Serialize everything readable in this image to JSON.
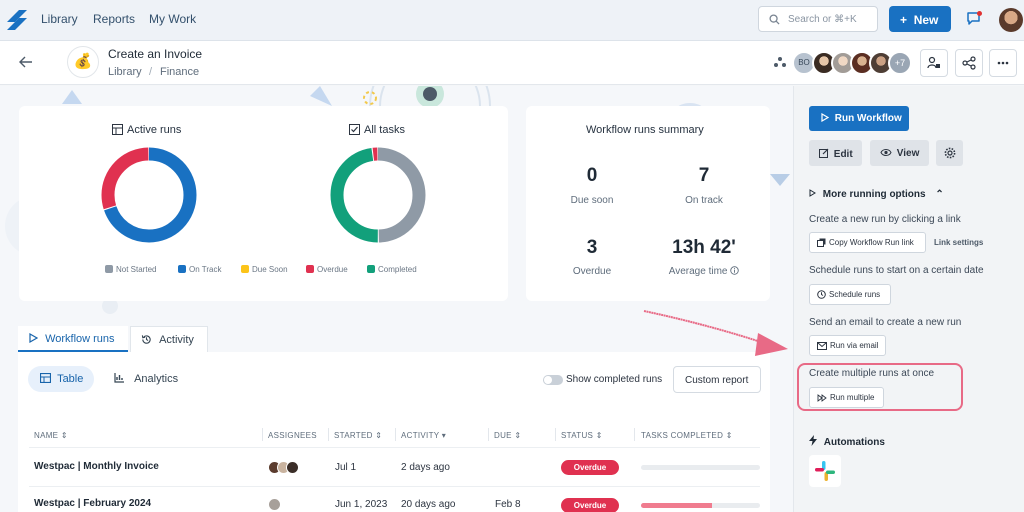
{
  "nav": {
    "library": "Library",
    "reports": "Reports",
    "my_work": "My Work",
    "search_placeholder": "Search or ⌘+K",
    "new_label": "New"
  },
  "header": {
    "title": "Create an Invoice",
    "crumb_library": "Library",
    "crumb_sep": "/",
    "crumb_finance": "Finance",
    "assignee_initials": "BO",
    "assignee_more": "+7",
    "icon": "💰"
  },
  "cards": {
    "active_runs": "Active runs",
    "all_tasks": "All tasks",
    "summary_title": "Workflow runs summary",
    "legend": [
      "Not Started",
      "On Track",
      "Due Soon",
      "Overdue",
      "Completed"
    ],
    "legend_colors": [
      "#8f9aa6",
      "#1971c2",
      "#fcc419",
      "#e03150",
      "#12a07b"
    ],
    "active_runs_chart": {
      "on_track": 7,
      "overdue": 3
    },
    "all_tasks_chart": {
      "completed": 48,
      "overdue": 2,
      "not_started": 50
    }
  },
  "summary": {
    "due_soon_value": "0",
    "due_soon_label": "Due soon",
    "on_track_value": "7",
    "on_track_label": "On track",
    "overdue_value": "3",
    "overdue_label": "Overdue",
    "avg_value": "13h 42'",
    "avg_label": "Average time"
  },
  "tabs": {
    "workflow_runs": "Workflow runs",
    "activity": "Activity",
    "table": "Table",
    "analytics": "Analytics",
    "show_completed": "Show completed runs",
    "custom_report": "Custom report"
  },
  "table": {
    "headers": [
      "NAME",
      "ASSIGNEES",
      "STARTED",
      "ACTIVITY",
      "DUE",
      "STATUS",
      "TASKS COMPLETED"
    ],
    "rows": [
      {
        "name": "Westpac | Monthly Invoice",
        "started": "Jul 1",
        "activity": "2 days ago",
        "due": "",
        "status": "Overdue",
        "progress": 0.0
      },
      {
        "name": "Westpac | February 2024",
        "started": "Jun 1, 2023",
        "activity": "20 days ago",
        "due": "Feb 8",
        "status": "Overdue",
        "progress": 0.6
      }
    ]
  },
  "panel": {
    "run_workflow": "Run Workflow",
    "edit": "Edit",
    "view": "View",
    "more_options": "More running options",
    "link_text": "Create a new run by clicking a link",
    "copy_link": "Copy Workflow Run link",
    "link_settings": "Link settings",
    "schedule_text": "Schedule runs to start on a certain date",
    "schedule_runs": "Schedule runs",
    "email_text": "Send an email to create a new run",
    "run_via_email": "Run via email",
    "multiple_text": "Create multiple runs at once",
    "run_multiple": "Run multiple",
    "automations": "Automations"
  }
}
